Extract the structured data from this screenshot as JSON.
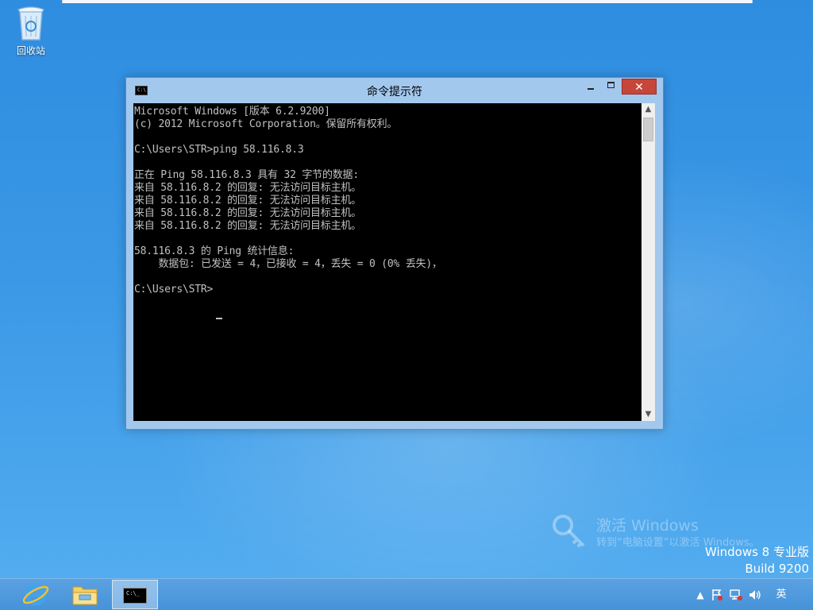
{
  "desktop": {
    "recycle_bin_label": "回收站"
  },
  "window": {
    "title": "命令提示符",
    "icon_text": "C:\\",
    "close_glyph": "✕",
    "console_lines": [
      "Microsoft Windows [版本 6.2.9200]",
      "(c) 2012 Microsoft Corporation。保留所有权利。",
      "",
      "C:\\Users\\STR>ping 58.116.8.3",
      "",
      "正在 Ping 58.116.8.3 具有 32 字节的数据:",
      "来自 58.116.8.2 的回复: 无法访问目标主机。",
      "来自 58.116.8.2 的回复: 无法访问目标主机。",
      "来自 58.116.8.2 的回复: 无法访问目标主机。",
      "来自 58.116.8.2 的回复: 无法访问目标主机。",
      "",
      "58.116.8.3 的 Ping 统计信息:",
      "    数据包: 已发送 = 4，已接收 = 4，丢失 = 0 (0% 丢失)，",
      "",
      "C:\\Users\\STR>"
    ]
  },
  "watermark": {
    "title": "激活 Windows",
    "subtitle": "转到“电脑设置”以激活 Windows。"
  },
  "os_info": {
    "edition": "Windows 8 专业版",
    "build": "Build 9200"
  },
  "taskbar": {
    "cmd_icon_text": "C:\\_",
    "tray_language": "英"
  },
  "colors": {
    "desktop": "#3a98e6",
    "window_frame": "#a3c8ee",
    "close_button": "#c7463a",
    "console_bg": "#000000",
    "console_text": "#c0c0c0"
  }
}
